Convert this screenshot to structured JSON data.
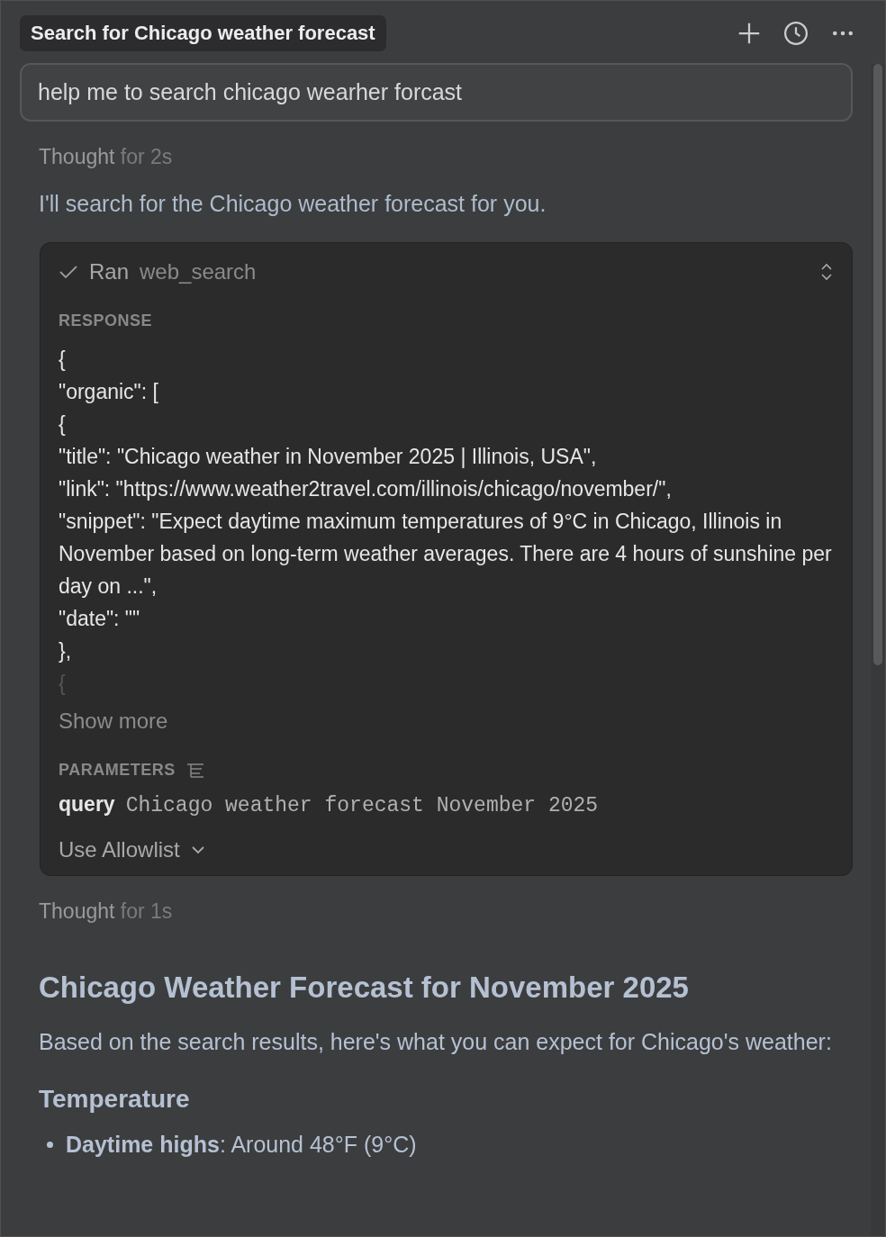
{
  "header": {
    "title": "Search for Chicago weather forecast"
  },
  "prompt": {
    "value": "help me to search chicago wearher forcast"
  },
  "thought_1": {
    "label": "Thought",
    "duration": "for 2s"
  },
  "intro": "I'll search for the Chicago weather forecast for you.",
  "tool_call": {
    "status": "Ran",
    "tool": "web_search",
    "expanded": true,
    "response_label": "RESPONSE",
    "response_lines": [
      "{",
      "\"organic\": [",
      "{",
      "\"title\": \"Chicago weather in November 2025 | Illinois, USA\",",
      "\"link\": \"https://www.weather2travel.com/illinois/chicago/november/\",",
      "\"snippet\": \"Expect daytime maximum temperatures of 9°C in Chicago, Illinois in November based on long-term weather averages. There are 4 hours of sunshine per day on ...\",",
      "\"date\": \"\"",
      "},",
      "{"
    ],
    "show_more": "Show more",
    "parameters_label": "PARAMETERS",
    "param_key": "query",
    "param_value": "Chicago weather forecast November 2025",
    "allowlist": "Use Allowlist"
  },
  "thought_2": {
    "label": "Thought",
    "duration": "for 1s"
  },
  "answer": {
    "heading": "Chicago Weather Forecast for November 2025",
    "paragraph": "Based on the search results, here's what you can expect for Chicago's weather:",
    "subheading": "Temperature",
    "bullets": [
      "**Daytime highs**: Around 48°F (9°C)"
    ]
  }
}
